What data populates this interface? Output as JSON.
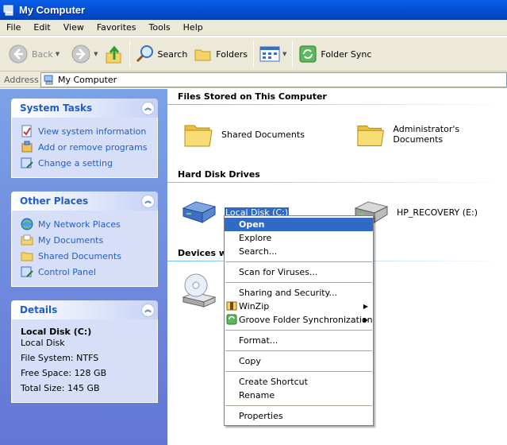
{
  "window": {
    "title": "My Computer"
  },
  "menu": [
    "File",
    "Edit",
    "View",
    "Favorites",
    "Tools",
    "Help"
  ],
  "toolbar": {
    "back": "Back",
    "search": "Search",
    "folders": "Folders",
    "folder_sync": "Folder Sync"
  },
  "address": {
    "label": "Address",
    "value": "My Computer"
  },
  "tasks": {
    "system": {
      "title": "System Tasks",
      "items": [
        "View system information",
        "Add or remove programs",
        "Change a setting"
      ]
    },
    "other": {
      "title": "Other Places",
      "items": [
        "My Network Places",
        "My Documents",
        "Shared Documents",
        "Control Panel"
      ]
    },
    "details": {
      "title": "Details",
      "name": "Local Disk (C:)",
      "type": "Local Disk",
      "filesystem": "File System: NTFS",
      "free": "Free Space: 128 GB",
      "total": "Total Size: 145 GB"
    }
  },
  "main": {
    "group_files": "Files Stored on This Computer",
    "shared_docs": "Shared Documents",
    "admin_docs": "Administrator's Documents",
    "group_drives": "Hard Disk Drives",
    "local_disk": "Local Disk (C:)",
    "recovery": "HP_RECOVERY (E:)",
    "group_devices": "Devices w"
  },
  "context_menu": {
    "open": "Open",
    "explore": "Explore",
    "search": "Search...",
    "scan": "Scan for Viruses...",
    "sharing": "Sharing and Security...",
    "winzip": "WinZip",
    "groove": "Groove Folder Synchronization",
    "format": "Format...",
    "copy": "Copy",
    "shortcut": "Create Shortcut",
    "rename": "Rename",
    "properties": "Properties"
  },
  "colors": {
    "accent": "#316ac5",
    "task_link": "#215dc6",
    "title_bar": "#0453d8"
  }
}
